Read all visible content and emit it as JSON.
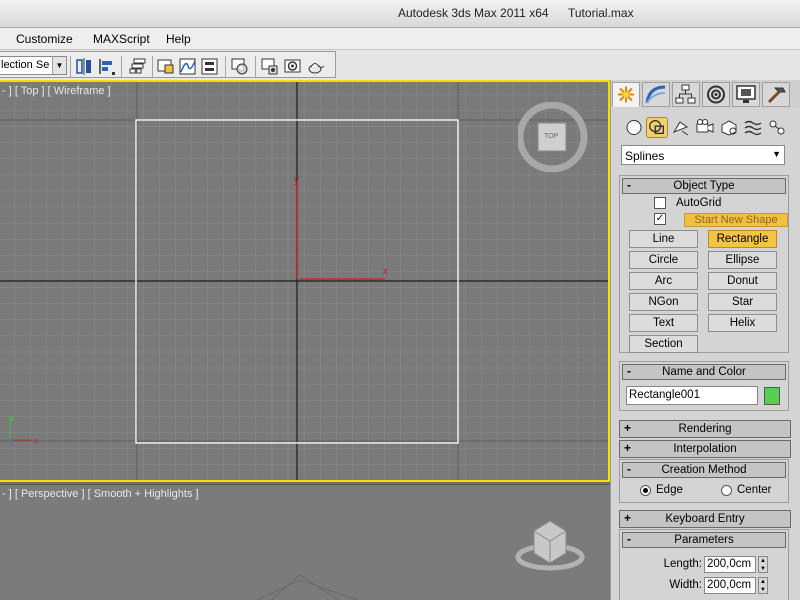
{
  "window": {
    "app_title": "Autodesk 3ds Max  2011 x64",
    "file_name": "Tutorial.max"
  },
  "menu": {
    "items": [
      "Customize",
      "MAXScript",
      "Help"
    ]
  },
  "toolbar": {
    "selection_set_value": "lection Se"
  },
  "viewports": {
    "top_label": "- ] [ Top ] [ Wireframe ]",
    "perspective_label": "- ] [ Perspective ] [ Smooth + Highlights ]",
    "viewcube_top_label": "TOP",
    "axis_x": "x",
    "axis_y": "y",
    "axis_z": "z"
  },
  "command_panel": {
    "category_dropdown": "Splines",
    "object_type": {
      "sign": "-",
      "title": "Object Type",
      "autogrid_label": "AutoGrid",
      "autogrid_checked": false,
      "start_new_shape_label": "Start New Shape",
      "start_new_shape_checked": true,
      "check_mark": "✓",
      "buttons": [
        "Line",
        "Rectangle",
        "Circle",
        "Ellipse",
        "Arc",
        "Donut",
        "NGon",
        "Star",
        "Text",
        "Helix",
        "Section"
      ],
      "active_button": "Rectangle"
    },
    "name_and_color": {
      "sign": "-",
      "title": "Name and Color",
      "name_value": "Rectangle001",
      "color": "#56d050"
    },
    "rendering": {
      "sign": "+",
      "title": "Rendering"
    },
    "interpolation": {
      "sign": "+",
      "title": "Interpolation"
    },
    "creation_method": {
      "sign": "-",
      "title": "Creation Method",
      "option_edge": "Edge",
      "option_center": "Center",
      "selected": "Edge"
    },
    "keyboard_entry": {
      "sign": "+",
      "title": "Keyboard Entry"
    },
    "parameters": {
      "sign": "-",
      "title": "Parameters",
      "length_label": "Length:",
      "length_value": "200,0cm",
      "width_label": "Width:",
      "width_value": "200,0cm"
    }
  },
  "colors": {
    "viewport_active_border": "#f0e000",
    "active_button": "#f3c342",
    "viewport_bg": "#7b7b7b"
  }
}
